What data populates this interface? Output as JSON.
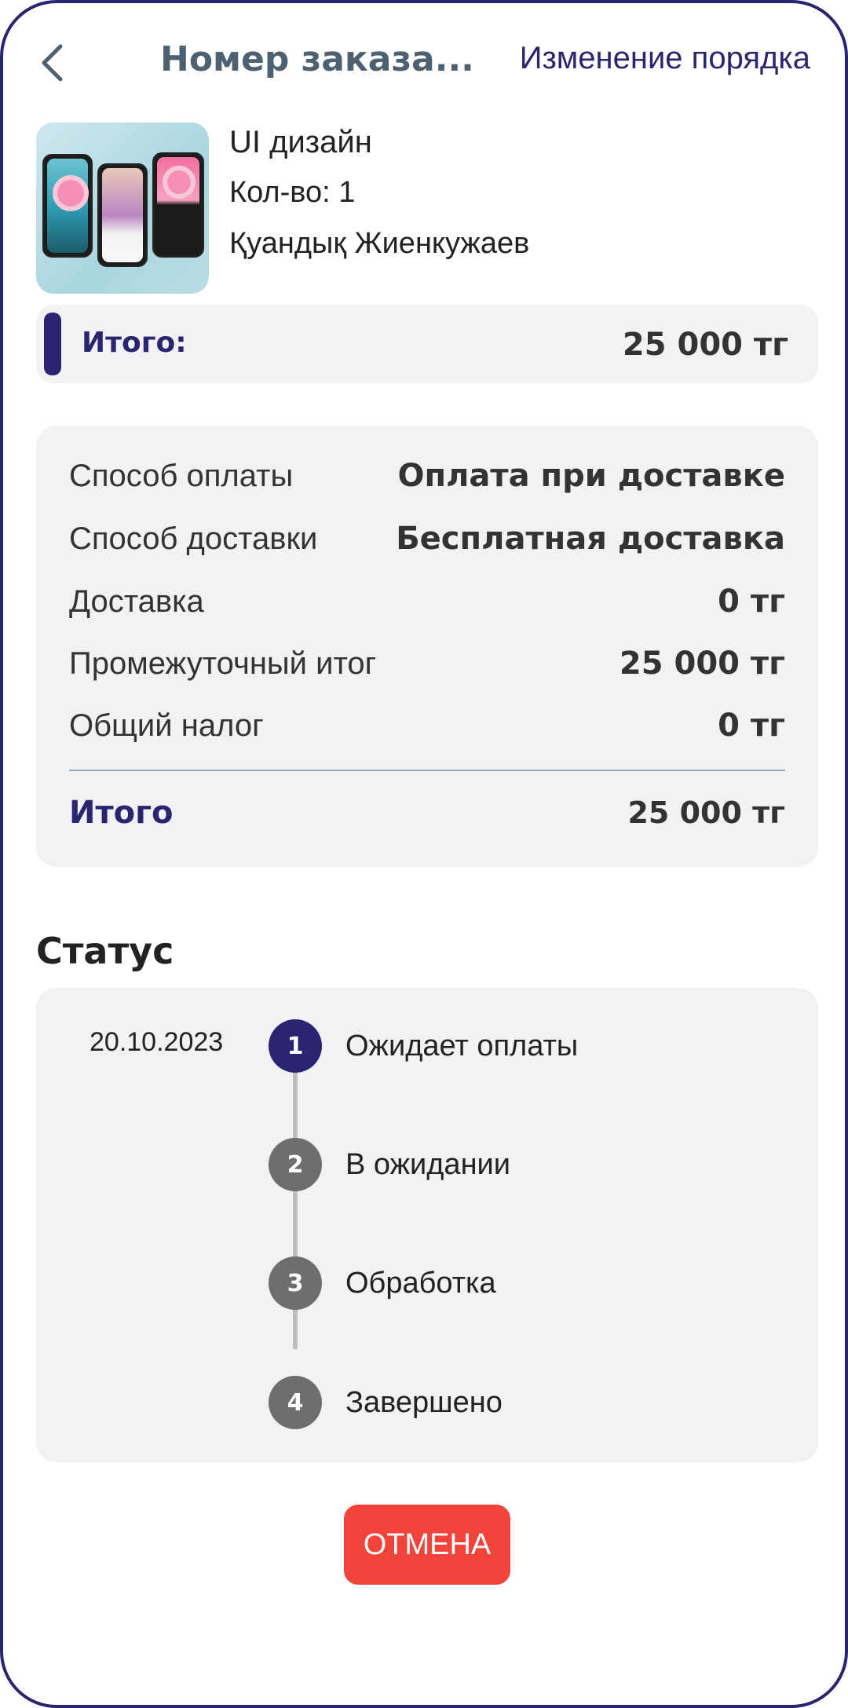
{
  "header": {
    "title": "Номер заказа...",
    "change_order_label": "Изменение порядка",
    "back_icon": "chevron-left-icon"
  },
  "product": {
    "name": "UI дизайн",
    "quantity": "Кол-во: 1",
    "seller": "Қуандық Жиенкужаев"
  },
  "total_bar": {
    "label": "Итого:",
    "value": "25 000 тг"
  },
  "summary": {
    "rows": [
      {
        "label": "Способ оплаты",
        "value": "Оплата при доставке"
      },
      {
        "label": "Способ доставки",
        "value": "Бесплатная доставка"
      },
      {
        "label": "Доставка",
        "value": "0 тг"
      },
      {
        "label": "Промежуточный итог",
        "value": "25 000 тг"
      },
      {
        "label": "Общий налог",
        "value": "0 тг"
      }
    ],
    "grand_total": {
      "label": "Итого",
      "value": "25 000 тг"
    }
  },
  "status": {
    "heading": "Статус",
    "date": "20.10.2023",
    "steps": [
      {
        "num": "1",
        "label": "Ожидает оплаты",
        "active": true
      },
      {
        "num": "2",
        "label": "В ожидании",
        "active": false
      },
      {
        "num": "3",
        "label": "Обработка",
        "active": false
      },
      {
        "num": "4",
        "label": "Завершено",
        "active": false
      }
    ]
  },
  "cancel_label": "ОТМЕНА",
  "colors": {
    "accent": "#2b2470",
    "cancel": "#f0443b",
    "card_bg": "#f2f2f4",
    "inactive_step": "#6e6e6e"
  }
}
